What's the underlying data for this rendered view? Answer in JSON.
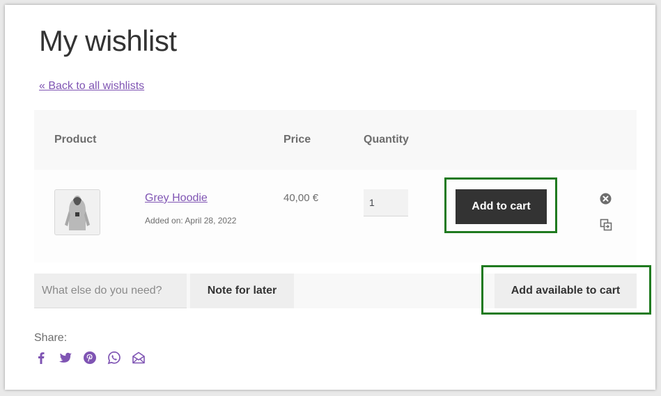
{
  "page": {
    "title": "My wishlist",
    "back_link": "« Back to all wishlists"
  },
  "table": {
    "headers": {
      "product": "Product",
      "price": "Price",
      "quantity": "Quantity"
    },
    "rows": [
      {
        "product_name": "Grey Hoodie",
        "added_on": "Added on: April 28, 2022",
        "price": "40,00 €",
        "quantity": "1",
        "add_to_cart_label": "Add to cart"
      }
    ]
  },
  "actions": {
    "note_placeholder": "What else do you need?",
    "note_button": "Note for later",
    "add_all_button": "Add available to cart"
  },
  "share": {
    "label": "Share:",
    "networks": [
      "facebook-icon",
      "twitter-icon",
      "pinterest-icon",
      "whatsapp-icon",
      "email-icon"
    ]
  },
  "colors": {
    "link": "#7f54b3",
    "dark_button": "#333333",
    "highlight": "#1f7a1f",
    "header_bg": "#f8f8f8"
  }
}
